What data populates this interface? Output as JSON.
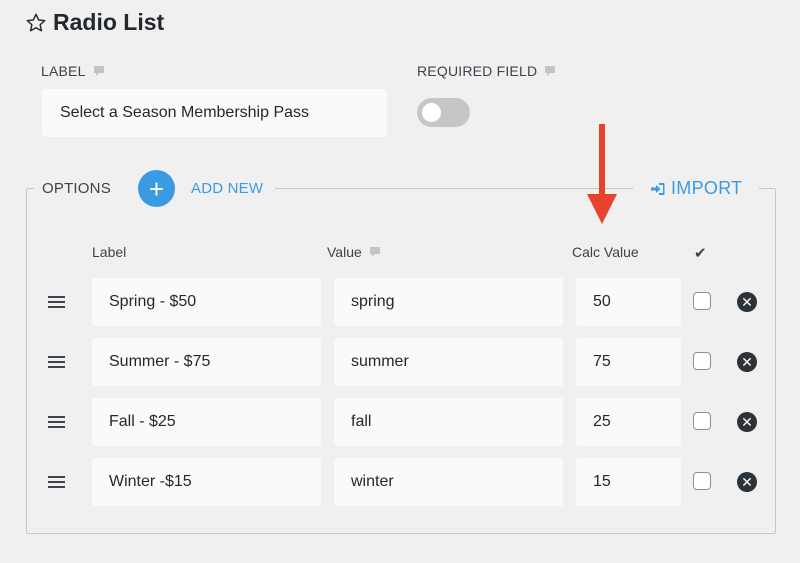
{
  "header": {
    "title": "Radio List",
    "icon": "star-outline-icon"
  },
  "label_field": {
    "heading": "LABEL",
    "value": "Select a Season Membership Pass"
  },
  "required_field": {
    "heading": "REQUIRED FIELD",
    "enabled": false
  },
  "options": {
    "heading": "OPTIONS",
    "add_new_label": "ADD NEW",
    "import_label": "IMPORT",
    "columns": {
      "label": "Label",
      "value": "Value",
      "calc_value": "Calc Value",
      "selected": "✔"
    },
    "rows": [
      {
        "label": "Spring - $50",
        "value": "spring",
        "calc": "50",
        "selected": false
      },
      {
        "label": "Summer - $75",
        "value": "summer",
        "calc": "75",
        "selected": false
      },
      {
        "label": "Fall - $25",
        "value": "fall",
        "calc": "25",
        "selected": false
      },
      {
        "label": "Winter -$15",
        "value": "winter",
        "calc": "15",
        "selected": false
      }
    ]
  },
  "colors": {
    "accent": "#3b9ae1",
    "annotation_arrow": "#e8412c"
  }
}
